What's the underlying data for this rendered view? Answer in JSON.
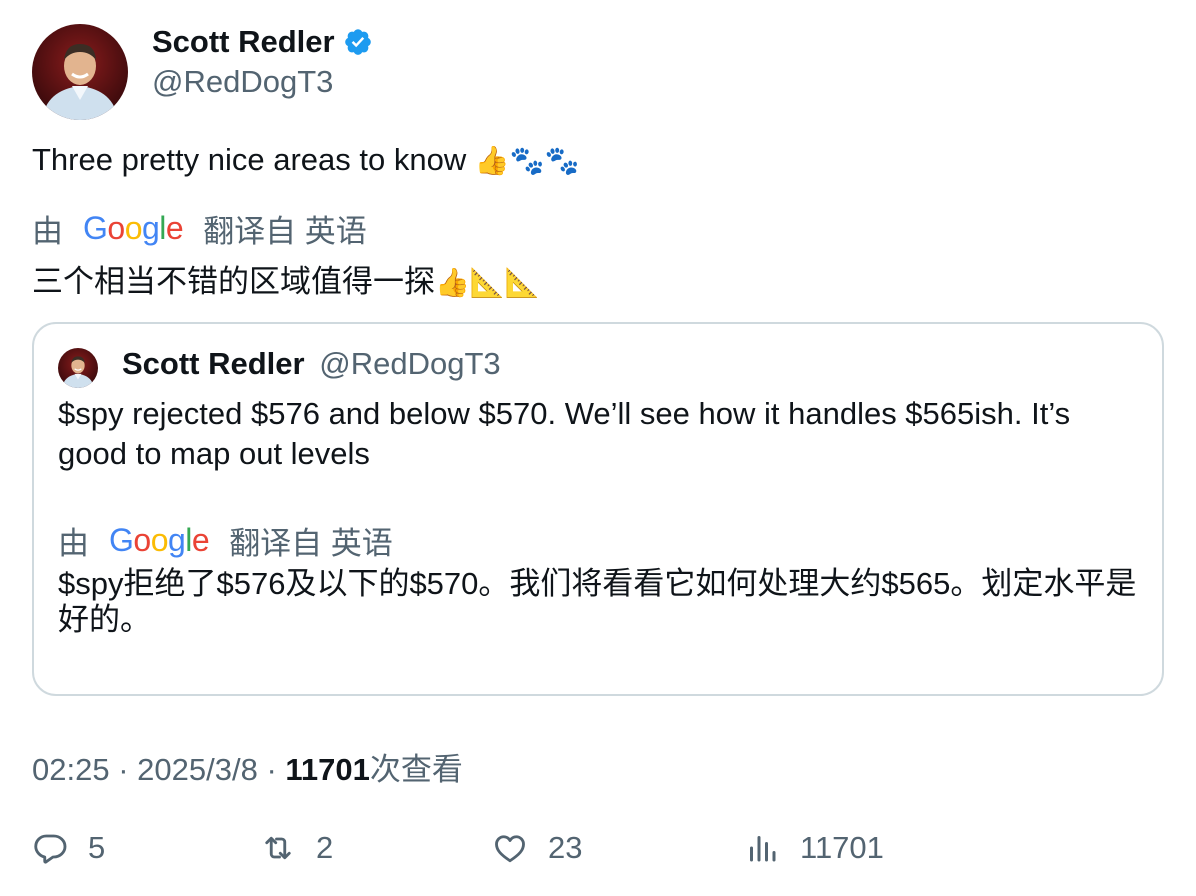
{
  "author": {
    "name": "Scott Redler",
    "handle": "@RedDogT3",
    "verified": true
  },
  "tweet": {
    "text": "Three pretty nice areas to know",
    "emojis": "👍🐾🐾",
    "translate_prefix": "由",
    "translate_brand": "Google",
    "translate_suffix": "翻译自 英语",
    "translated_text": "三个相当不错的区域值得一探",
    "translated_emojis": "👍📐📐"
  },
  "quote": {
    "name": "Scott Redler",
    "handle": "@RedDogT3",
    "text": "$spy rejected $576 and below $570. We’ll see how it handles $565ish. It’s good to map out levels",
    "translate_prefix": "由",
    "translate_brand": "Google",
    "translate_suffix": "翻译自 英语",
    "translated_text": "$spy拒绝了$576及以下的$570。我们将看看它如何处理大约$565。划定水平是好的。"
  },
  "meta": {
    "time": "02:25",
    "separator": "·",
    "date": "2025/3/8",
    "views": "11701",
    "views_label": "次查看"
  },
  "actions": {
    "replies": "5",
    "retweets": "2",
    "likes": "23",
    "views": "11701"
  },
  "colors": {
    "verified": "#1d9bf0",
    "secondary_text": "#536471",
    "primary_text": "#0f1419",
    "border": "#cfd9de"
  },
  "icons": [
    "verified-badge-icon",
    "reply-icon",
    "retweet-icon",
    "like-icon",
    "views-icon"
  ]
}
